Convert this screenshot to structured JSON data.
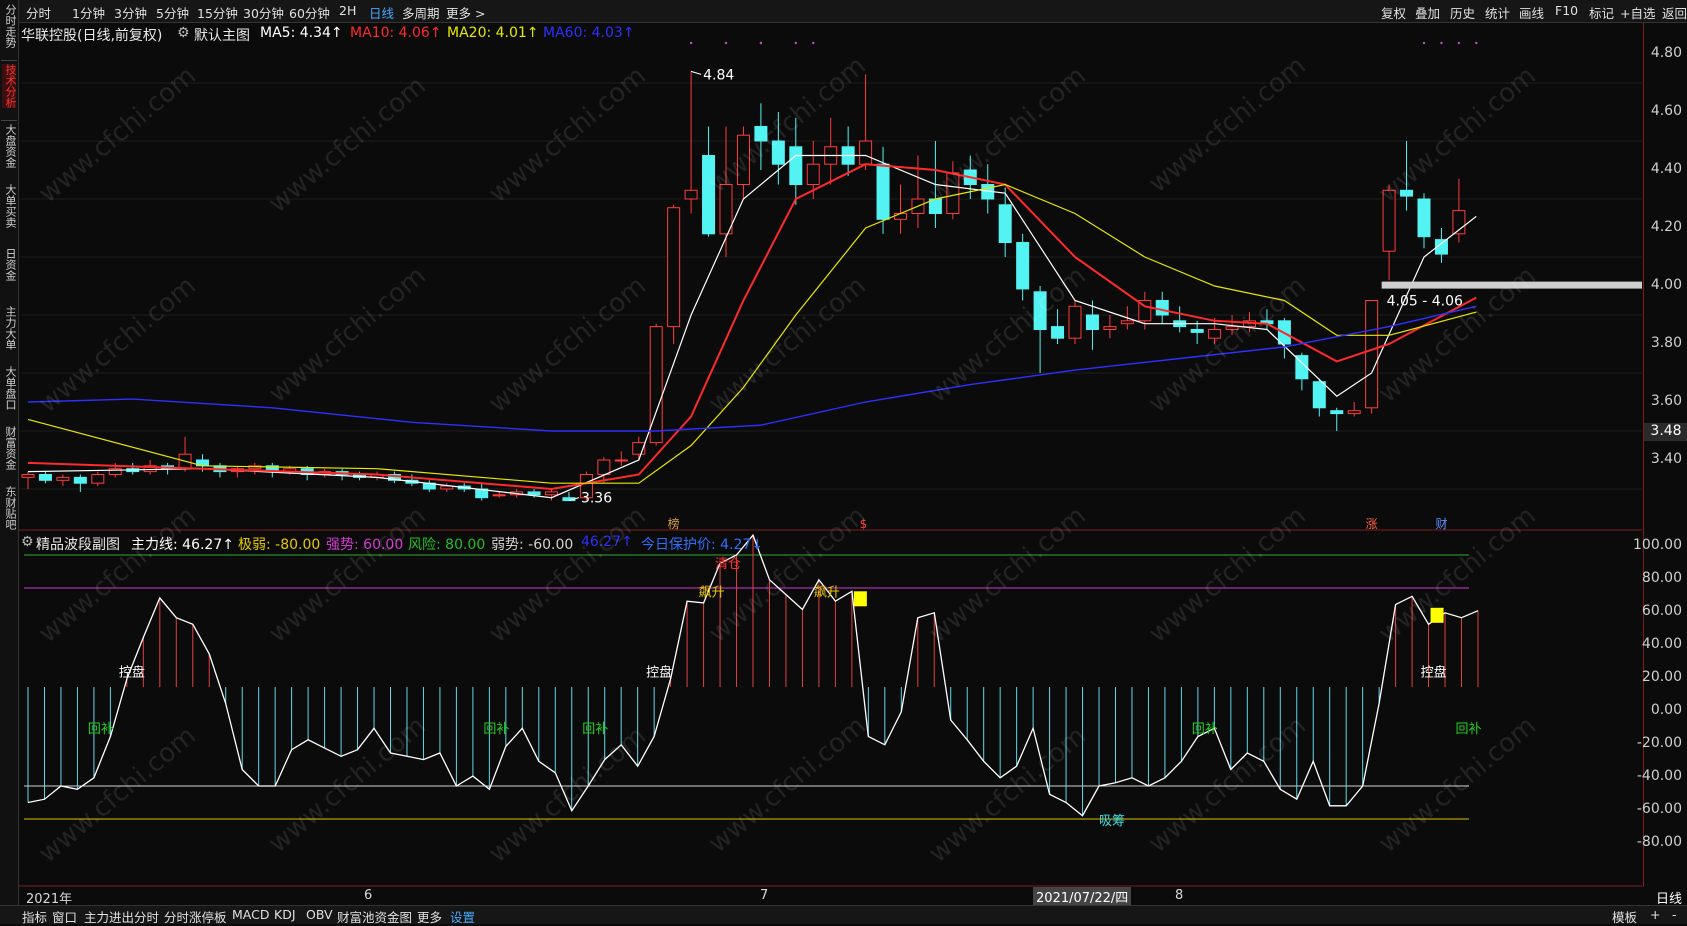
{
  "periods": [
    "分时",
    "1分钟",
    "3分钟",
    "5分钟",
    "15分钟",
    "30分钟",
    "60分钟",
    "2H",
    "日线",
    "多周期",
    "更多 >"
  ],
  "active_period": "日线",
  "toolbar_right": [
    "复权",
    "叠加",
    "历史",
    "统计",
    "画线",
    "F10",
    "标记",
    "+自选",
    "返回"
  ],
  "sidebar": [
    "分时走势",
    "技术分析",
    "大盘资金",
    "大单买卖",
    "日资金",
    "主力大单",
    "大单盘口",
    "财富资金",
    "东财贴吧"
  ],
  "sidebar_active": "技术分析",
  "main": {
    "title": "华联控股(日线,前复权)",
    "template": "默认主图",
    "ma5": "MA5: 4.34↑",
    "ma10": "MA10: 4.06↑",
    "ma20": "MA20: 4.01↑",
    "ma60": "MA60: 4.03↑",
    "high_label": "4.84",
    "low_label": "3.36",
    "range_label": "4.05 - 4.06",
    "price_tag": "3.48",
    "y_ticks": [
      "4.80",
      "4.60",
      "4.40",
      "4.20",
      "4.00",
      "3.80",
      "3.60",
      "3.40"
    ],
    "markers": [
      "榜",
      "$",
      "涨",
      "财"
    ],
    "colors": {
      "ma5": "#ffffff",
      "ma10": "#ff2a2a",
      "ma20": "#e8e800",
      "ma60": "#2f2fff",
      "up": "#ff3b3b",
      "down": "#53f3f3"
    }
  },
  "sub": {
    "name": "精品波段副图",
    "zhulixian": "主力线: 46.27↑",
    "jiruo": "极弱: -80.00",
    "qiangshi": "强势: 60.00",
    "fengxian": "风险: 80.00",
    "ruoshi": "弱势: -60.00",
    "val": "46.27↑",
    "baohu": "今日保护价: 4.27↓",
    "y_ticks": [
      "100.00",
      "80.00",
      "60.00",
      "40.00",
      "20.00",
      "0.00",
      "-20.00",
      "-40.00",
      "-60.00",
      "-80.00"
    ],
    "signals": {
      "kongpan": "控盘",
      "huibu": "回补",
      "piaosheng": "飙升",
      "qingcang": "清仓",
      "xichou": "吸筹"
    }
  },
  "x_axis": {
    "year": "2021年",
    "m6": "6",
    "m7": "7",
    "date": "2021/07/22/四",
    "m8": "8",
    "mode": "日线"
  },
  "bottom_tabs": [
    "指标",
    "窗口",
    "主力进出分时",
    "分时涨停板",
    "MACD",
    "KDJ",
    "OBV",
    "财富池资金图",
    "更多",
    "设置"
  ],
  "bottom_active": "设置",
  "bottom_right": [
    "模板",
    "+",
    "-"
  ],
  "watermark": "www.cfchi.com",
  "chart_data": {
    "type": "candlestick",
    "ylim": [
      3.3,
      4.9
    ],
    "candles": [
      [
        3.44,
        3.45,
        3.4,
        3.46
      ],
      [
        3.45,
        3.43,
        3.42,
        3.46
      ],
      [
        3.43,
        3.44,
        3.41,
        3.45
      ],
      [
        3.44,
        3.42,
        3.39,
        3.45
      ],
      [
        3.42,
        3.45,
        3.41,
        3.46
      ],
      [
        3.45,
        3.47,
        3.44,
        3.49
      ],
      [
        3.47,
        3.46,
        3.45,
        3.49
      ],
      [
        3.46,
        3.48,
        3.45,
        3.5
      ],
      [
        3.48,
        3.47,
        3.45,
        3.49
      ],
      [
        3.47,
        3.52,
        3.46,
        3.58
      ],
      [
        3.5,
        3.48,
        3.46,
        3.52
      ],
      [
        3.48,
        3.46,
        3.44,
        3.49
      ],
      [
        3.46,
        3.47,
        3.44,
        3.48
      ],
      [
        3.47,
        3.48,
        3.45,
        3.49
      ],
      [
        3.48,
        3.46,
        3.44,
        3.49
      ],
      [
        3.46,
        3.47,
        3.45,
        3.48
      ],
      [
        3.47,
        3.45,
        3.43,
        3.48
      ],
      [
        3.45,
        3.46,
        3.44,
        3.47
      ],
      [
        3.46,
        3.45,
        3.43,
        3.47
      ],
      [
        3.45,
        3.44,
        3.43,
        3.46
      ],
      [
        3.44,
        3.45,
        3.43,
        3.46
      ],
      [
        3.45,
        3.43,
        3.42,
        3.46
      ],
      [
        3.43,
        3.42,
        3.41,
        3.45
      ],
      [
        3.42,
        3.4,
        3.39,
        3.43
      ],
      [
        3.4,
        3.41,
        3.39,
        3.42
      ],
      [
        3.41,
        3.4,
        3.39,
        3.42
      ],
      [
        3.4,
        3.37,
        3.36,
        3.42
      ],
      [
        3.38,
        3.38,
        3.37,
        3.39
      ],
      [
        3.38,
        3.39,
        3.37,
        3.4
      ],
      [
        3.39,
        3.38,
        3.37,
        3.4
      ],
      [
        3.38,
        3.39,
        3.36,
        3.4
      ],
      [
        3.37,
        3.36,
        3.36,
        3.39
      ],
      [
        3.37,
        3.45,
        3.36,
        3.46
      ],
      [
        3.45,
        3.5,
        3.42,
        3.51
      ],
      [
        3.5,
        3.5,
        3.48,
        3.53
      ],
      [
        3.52,
        3.56,
        3.5,
        3.58
      ],
      [
        3.56,
        3.96,
        3.55,
        3.97
      ],
      [
        3.96,
        4.37,
        3.9,
        4.38
      ],
      [
        4.4,
        4.43,
        4.35,
        4.84
      ],
      [
        4.55,
        4.28,
        4.27,
        4.65
      ],
      [
        4.28,
        4.45,
        4.2,
        4.65
      ],
      [
        4.45,
        4.62,
        4.4,
        4.65
      ],
      [
        4.65,
        4.6,
        4.5,
        4.73
      ],
      [
        4.6,
        4.52,
        4.45,
        4.7
      ],
      [
        4.58,
        4.45,
        4.38,
        4.68
      ],
      [
        4.45,
        4.52,
        4.4,
        4.6
      ],
      [
        4.52,
        4.58,
        4.45,
        4.68
      ],
      [
        4.58,
        4.52,
        4.48,
        4.65
      ],
      [
        4.52,
        4.6,
        4.5,
        4.83
      ],
      [
        4.52,
        4.33,
        4.28,
        4.58
      ],
      [
        4.33,
        4.35,
        4.28,
        4.45
      ],
      [
        4.35,
        4.4,
        4.3,
        4.55
      ],
      [
        4.4,
        4.35,
        4.3,
        4.6
      ],
      [
        4.35,
        4.49,
        4.33,
        4.53
      ],
      [
        4.5,
        4.45,
        4.4,
        4.55
      ],
      [
        4.45,
        4.4,
        4.35,
        4.52
      ],
      [
        4.38,
        4.25,
        4.2,
        4.44
      ],
      [
        4.25,
        4.09,
        4.05,
        4.28
      ],
      [
        4.08,
        3.95,
        3.8,
        4.1
      ],
      [
        3.96,
        3.92,
        3.9,
        4.02
      ],
      [
        3.92,
        4.03,
        3.9,
        4.05
      ],
      [
        4.0,
        3.95,
        3.88,
        4.05
      ],
      [
        3.95,
        3.96,
        3.92,
        4.0
      ],
      [
        3.97,
        3.98,
        3.95,
        4.03
      ],
      [
        3.98,
        4.05,
        3.95,
        4.08
      ],
      [
        4.05,
        4.0,
        3.97,
        4.08
      ],
      [
        3.98,
        3.96,
        3.94,
        4.03
      ],
      [
        3.95,
        3.94,
        3.9,
        3.98
      ],
      [
        3.92,
        3.95,
        3.9,
        3.99
      ],
      [
        3.95,
        3.96,
        3.93,
        4.0
      ],
      [
        3.96,
        3.98,
        3.94,
        4.01
      ],
      [
        3.98,
        3.97,
        3.95,
        4.02
      ],
      [
        3.98,
        3.9,
        3.85,
        3.99
      ],
      [
        3.86,
        3.78,
        3.74,
        3.87
      ],
      [
        3.77,
        3.68,
        3.65,
        3.78
      ],
      [
        3.67,
        3.66,
        3.6,
        3.68
      ],
      [
        3.66,
        3.67,
        3.65,
        3.7
      ],
      [
        3.68,
        4.05,
        3.66,
        4.05
      ],
      [
        4.22,
        4.43,
        4.12,
        4.45
      ],
      [
        4.43,
        4.41,
        4.36,
        4.6
      ],
      [
        4.4,
        4.27,
        4.23,
        4.42
      ],
      [
        4.26,
        4.21,
        4.18,
        4.3
      ],
      [
        4.28,
        4.36,
        4.25,
        4.47
      ]
    ],
    "ma": {
      "ma5": [
        [
          0,
          3.46
        ],
        [
          10,
          3.47
        ],
        [
          20,
          3.44
        ],
        [
          30,
          3.37
        ],
        [
          35,
          3.5
        ],
        [
          38,
          4.0
        ],
        [
          41,
          4.4
        ],
        [
          44,
          4.55
        ],
        [
          48,
          4.55
        ],
        [
          52,
          4.45
        ],
        [
          56,
          4.42
        ],
        [
          60,
          4.05
        ],
        [
          64,
          3.97
        ],
        [
          68,
          3.97
        ],
        [
          71,
          3.95
        ],
        [
          75,
          3.72
        ],
        [
          77,
          3.8
        ],
        [
          80,
          4.2
        ],
        [
          83,
          4.34
        ]
      ],
      "ma10": [
        [
          0,
          3.49
        ],
        [
          10,
          3.47
        ],
        [
          20,
          3.45
        ],
        [
          30,
          3.4
        ],
        [
          35,
          3.45
        ],
        [
          38,
          3.65
        ],
        [
          41,
          4.05
        ],
        [
          44,
          4.4
        ],
        [
          48,
          4.52
        ],
        [
          52,
          4.5
        ],
        [
          56,
          4.45
        ],
        [
          60,
          4.2
        ],
        [
          64,
          4.03
        ],
        [
          68,
          3.98
        ],
        [
          71,
          3.97
        ],
        [
          75,
          3.84
        ],
        [
          78,
          3.9
        ],
        [
          83,
          4.06
        ]
      ],
      "ma20": [
        [
          0,
          3.64
        ],
        [
          10,
          3.48
        ],
        [
          20,
          3.47
        ],
        [
          30,
          3.42
        ],
        [
          35,
          3.42
        ],
        [
          38,
          3.55
        ],
        [
          41,
          3.75
        ],
        [
          44,
          4.0
        ],
        [
          48,
          4.3
        ],
        [
          52,
          4.4
        ],
        [
          56,
          4.45
        ],
        [
          60,
          4.35
        ],
        [
          64,
          4.2
        ],
        [
          68,
          4.1
        ],
        [
          72,
          4.05
        ],
        [
          75,
          3.93
        ],
        [
          78,
          3.93
        ],
        [
          83,
          4.01
        ]
      ],
      "ma60": [
        [
          0,
          3.7
        ],
        [
          6,
          3.71
        ],
        [
          14,
          3.68
        ],
        [
          22,
          3.63
        ],
        [
          30,
          3.6
        ],
        [
          36,
          3.6
        ],
        [
          42,
          3.62
        ],
        [
          48,
          3.7
        ],
        [
          54,
          3.76
        ],
        [
          60,
          3.81
        ],
        [
          66,
          3.85
        ],
        [
          72,
          3.89
        ],
        [
          78,
          3.96
        ],
        [
          83,
          4.03
        ]
      ]
    },
    "sub_line": [
      -70,
      -68,
      -60,
      -62,
      -55,
      -30,
      5,
      30,
      54,
      42,
      38,
      20,
      -10,
      -50,
      -60,
      -60,
      -38,
      -32,
      -37,
      -42,
      -38,
      -25,
      -40,
      -42,
      -44,
      -40,
      -60,
      -54,
      -62,
      -36,
      -25,
      -45,
      -52,
      -75,
      -60,
      -44,
      -35,
      -48,
      -30,
      5,
      52,
      51,
      75,
      80,
      92,
      65,
      56,
      47,
      65,
      52,
      58,
      -30,
      -35,
      -15,
      42,
      45,
      -20,
      -32,
      -45,
      -55,
      -48,
      -25,
      -65,
      -70,
      -78,
      -60,
      -58,
      -55,
      -60,
      -55,
      -45,
      -30,
      -25,
      -50,
      -40,
      -45,
      -62,
      -68,
      -45,
      -72,
      -72,
      -60,
      -10,
      50,
      55,
      38,
      45,
      42,
      46.27
    ]
  }
}
